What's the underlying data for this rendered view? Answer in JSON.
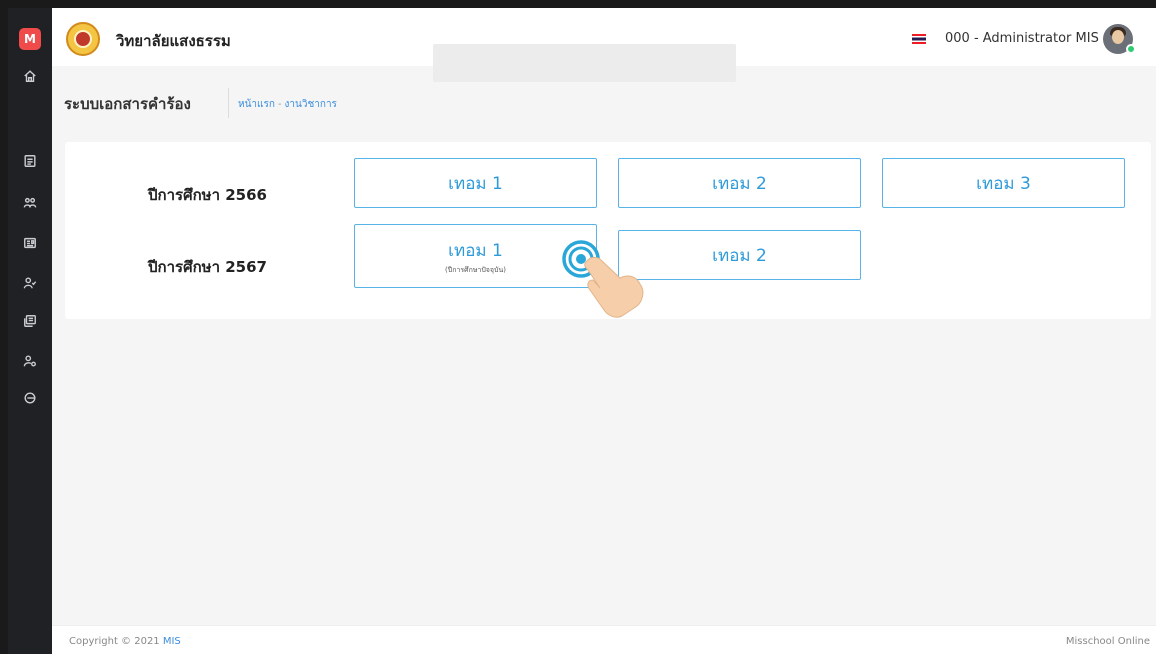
{
  "sidebar": {
    "logo_letter": "M",
    "items": [
      {
        "icon": "home-icon"
      },
      {
        "icon": "document-icon"
      },
      {
        "icon": "users-icon"
      },
      {
        "icon": "id-card-icon"
      },
      {
        "icon": "user-check-icon"
      },
      {
        "icon": "stack-icon"
      },
      {
        "icon": "user-settings-icon"
      },
      {
        "icon": "logout-icon"
      }
    ]
  },
  "header": {
    "school_name": "วิทยาลัยแสงธรรม",
    "user_name": "000 - Administrator MIS",
    "language_flag": "thai-flag-icon"
  },
  "page": {
    "title": "ระบบเอกสารคำร้อง",
    "breadcrumb": [
      "หน้าแรก",
      "งานวิชาการ"
    ],
    "breadcrumb_separator": "-"
  },
  "years": [
    {
      "label": "ปีการศึกษา 2566",
      "terms": [
        {
          "label": "เทอม 1",
          "note": ""
        },
        {
          "label": "เทอม 2",
          "note": ""
        },
        {
          "label": "เทอม 3",
          "note": ""
        }
      ]
    },
    {
      "label": "ปีการศึกษา 2567",
      "terms": [
        {
          "label": "เทอม 1",
          "note": "(ปีการศึกษาปัจจุบัน)"
        },
        {
          "label": "เทอม 2",
          "note": ""
        }
      ]
    }
  ],
  "footer": {
    "copyright_prefix": "Copyright © 2021",
    "copyright_brand": "MIS",
    "right_text": "Misschool Online"
  },
  "colors": {
    "accent": "#2d9ad9",
    "sidebar_bg": "#1f2125",
    "logo_red": "#ef4b4b",
    "online_green": "#2ecc71"
  }
}
